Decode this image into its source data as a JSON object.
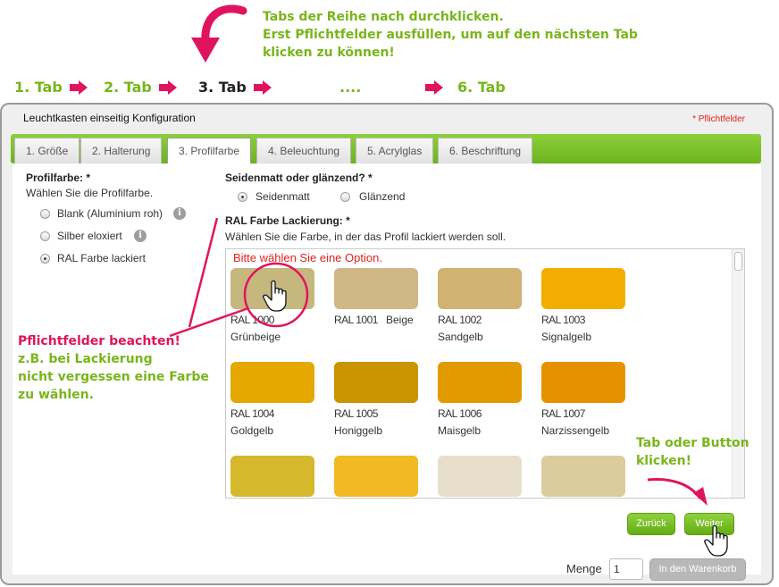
{
  "annotations": {
    "top_note": [
      "Tabs der Reihe nach durchklicken.",
      "Erst Pflichtfelder ausfüllen, um auf den nächsten Tab",
      "klicken zu können!"
    ],
    "steps": [
      "1. Tab",
      "2. Tab",
      "3. Tab",
      "....",
      "6. Tab"
    ],
    "pflicht_note": [
      "Pflichtfelder beachten!",
      "z.B. bei Lackierung",
      "nicht vergessen eine Farbe",
      "zu wählen."
    ],
    "button_note": [
      "Tab oder Button",
      "klicken!"
    ]
  },
  "panel": {
    "title": "Leuchtkasten einseitig Konfiguration",
    "required_hint": "* Pflichtfelder",
    "tabs": [
      {
        "label": "1. Größe"
      },
      {
        "label": "2. Halterung"
      },
      {
        "label": "3. Profilfarbe"
      },
      {
        "label": "4. Beleuchtung"
      },
      {
        "label": "5. Acrylglas"
      },
      {
        "label": "6. Beschriftung"
      }
    ],
    "active_tab": 2
  },
  "profilfarbe": {
    "label": "Profilfarbe: *",
    "hint": "Wählen Sie die Profilfarbe.",
    "options": [
      {
        "label": "Blank (Aluminium roh)",
        "selected": false
      },
      {
        "label": "Silber eloxiert",
        "selected": false
      },
      {
        "label": "RAL Farbe lackiert",
        "selected": true
      }
    ],
    "info_glyph": "i"
  },
  "finish": {
    "label": "Seidenmatt oder glänzend? *",
    "options": [
      {
        "label": "Seidenmatt",
        "selected": true
      },
      {
        "label": "Glänzend",
        "selected": false
      }
    ]
  },
  "ral": {
    "label": "RAL Farbe Lackierung: *",
    "hint": "Wählen Sie die Farbe, in der das Profil lackiert werden soll.",
    "error": "Bitte wählen Sie eine Option.",
    "swatches": [
      {
        "code": "RAL 1000",
        "name": "Grünbeige",
        "color": "#c6b77f"
      },
      {
        "code": "RAL 1001",
        "name": "Beige",
        "color": "#d1b686"
      },
      {
        "code": "RAL 1002",
        "name": "Sandgelb",
        "color": "#d0b273"
      },
      {
        "code": "RAL 1003",
        "name": "Signalgelb",
        "color": "#f3ad00"
      },
      {
        "code": "RAL 1004",
        "name": "Goldgelb",
        "color": "#e4a800"
      },
      {
        "code": "RAL 1005",
        "name": "Honiggelb",
        "color": "#c99400"
      },
      {
        "code": "RAL 1006",
        "name": "Maisgelb",
        "color": "#e19b00"
      },
      {
        "code": "RAL 1007",
        "name": "Narzissengelb",
        "color": "#e69200"
      },
      {
        "code": "",
        "name": "",
        "color": "#d6b82c"
      },
      {
        "code": "",
        "name": "",
        "color": "#f1b923"
      },
      {
        "code": "",
        "name": "",
        "color": "#e7dfcc"
      },
      {
        "code": "",
        "name": "",
        "color": "#dccb9c"
      }
    ]
  },
  "buttons": {
    "back": "Zurück",
    "next": "Weiter",
    "qty_label": "Menge",
    "qty_value": "1",
    "cart": "In den Warenkorb"
  },
  "colors": {
    "accent_green": "#79b51c",
    "accent_pink": "#e0145e",
    "error_red": "#e02020"
  }
}
